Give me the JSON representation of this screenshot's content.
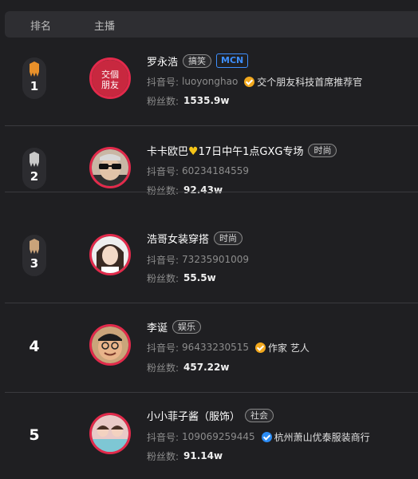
{
  "header": {
    "rank_label": "排名",
    "anchor_label": "主播"
  },
  "labels": {
    "id_prefix": "抖音号:",
    "fans_prefix": "粉丝数:"
  },
  "rows": [
    {
      "rank": "1",
      "name": "罗永浩",
      "tags": [
        "搞笑"
      ],
      "badge": "MCN",
      "douyin_id": "luoyonghao",
      "verify": "交个朋友科技首席推荐官",
      "verify_color": "gold",
      "fans": "1535.9w",
      "medal": "gold"
    },
    {
      "rank": "2",
      "name_pre": "卡卡欧巴",
      "name_post": "17日中午1点GXG专场",
      "tags": [
        "时尚"
      ],
      "douyin_id": "60234184559",
      "fans": "92.43w",
      "medal": "silver"
    },
    {
      "rank": "3",
      "name": "浩哥女装穿搭",
      "tags": [
        "时尚"
      ],
      "douyin_id": "73235901009",
      "fans": "55.5w",
      "medal": "bronze"
    },
    {
      "rank": "4",
      "name": "李诞",
      "tags": [
        "娱乐"
      ],
      "douyin_id": "96433230515",
      "verify": "作家 艺人",
      "verify_color": "gold",
      "fans": "457.22w"
    },
    {
      "rank": "5",
      "name": "小小菲子酱（服饰）",
      "tags": [
        "社会"
      ],
      "douyin_id": "109069259445",
      "verify": "杭州萧山优泰服装商行",
      "verify_color": "blue",
      "fans": "91.14w"
    }
  ],
  "colors": {
    "medal_gold": "#e8902a",
    "medal_silver": "#c9c9c9",
    "medal_bronze": "#c9a37a",
    "avatar_ring": "#e22a4b",
    "mcn_blue": "#3d8fff"
  }
}
